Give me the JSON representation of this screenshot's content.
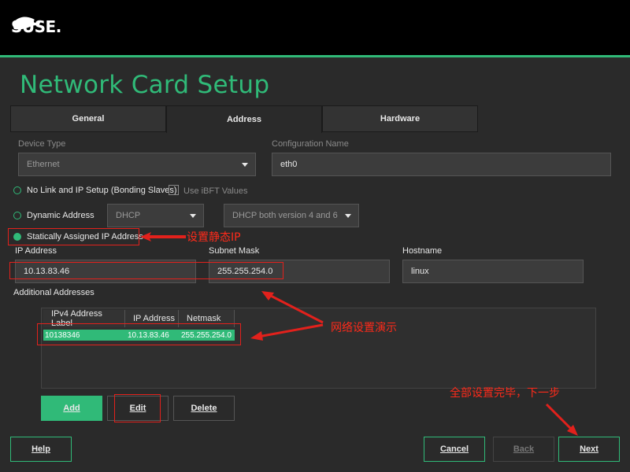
{
  "brand": {
    "logo_text": "SUSE.",
    "accent": "#30ba78"
  },
  "page": {
    "title": "Network Card Setup"
  },
  "tabs": [
    {
      "label": "General"
    },
    {
      "label": "Address"
    },
    {
      "label": "Hardware"
    }
  ],
  "device": {
    "type_label": "Device Type",
    "type_value": "Ethernet",
    "config_label": "Configuration Name",
    "config_value": "eth0"
  },
  "options": {
    "no_link_label": "No Link and IP Setup (Bonding Slaves)",
    "ibft_label": "Use iBFT Values",
    "dynamic_label": "Dynamic Address",
    "dynamic_mode": "DHCP",
    "dhcp_version": "DHCP both version 4 and 6",
    "static_label": "Statically Assigned IP Address"
  },
  "address": {
    "ip_label": "IP Address",
    "ip_value": "10.13.83.46",
    "mask_label": "Subnet Mask",
    "mask_value": "255.255.254.0",
    "hostname_label": "Hostname",
    "hostname_value": "linux"
  },
  "additional": {
    "title": "Additional Addresses",
    "columns": [
      "IPv4 Address Label",
      "IP Address",
      "Netmask"
    ],
    "rows": [
      [
        "10138346",
        "10.13.83.46",
        "255.255.254.0"
      ]
    ]
  },
  "buttons": {
    "add": "Add",
    "edit": "Edit",
    "delete": "Delete",
    "help": "Help",
    "cancel": "Cancel",
    "back": "Back",
    "next": "Next"
  },
  "annotations": {
    "static_ip": "设置静态IP",
    "network_demo": "网络设置演示",
    "all_done": "全部设置完毕，下一步"
  }
}
